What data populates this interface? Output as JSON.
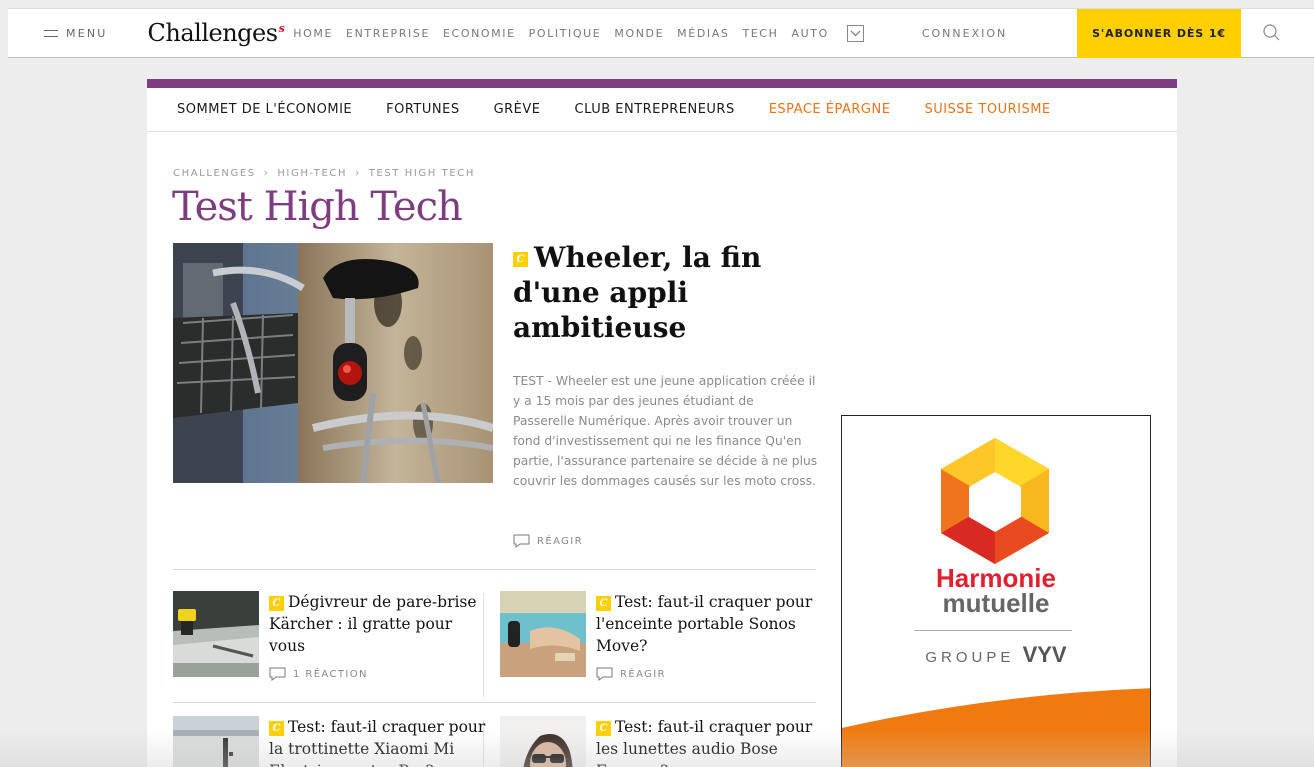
{
  "header": {
    "menu_label": "MENU",
    "logo": "Challenges",
    "nav": [
      "HOME",
      "ENTREPRISE",
      "ECONOMIE",
      "POLITIQUE",
      "MONDE",
      "MÉDIAS",
      "TECH",
      "AUTO"
    ],
    "connexion": "CONNEXION",
    "subscribe": "S'ABONNER DÈS 1€"
  },
  "subnav": [
    {
      "label": "SOMMET DE L'ÉCONOMIE",
      "color": "#1a1a1a"
    },
    {
      "label": "FORTUNES",
      "color": "#1a1a1a"
    },
    {
      "label": "GRÈVE",
      "color": "#1a1a1a"
    },
    {
      "label": "CLUB ENTREPRENEURS",
      "color": "#1a1a1a"
    },
    {
      "label": "ESPACE ÉPARGNE",
      "color": "#e8731a"
    },
    {
      "label": "SUISSE TOURISME",
      "color": "#e8731a"
    }
  ],
  "breadcrumb": [
    "CHALLENGES",
    "HIGH-TECH",
    "TEST HIGH TECH"
  ],
  "page_title": "Test High Tech",
  "badge_letter": "C",
  "hero": {
    "title": "Wheeler, la fin d'une appli ambitieuse",
    "description": "TEST - Wheeler est une jeune application créée il y a 15 mois par des jeunes étudiant de Passerelle Numérique. Après avoir trouver un fond d'investissement qui ne les finance Qu'en partie, l'assurance partenaire se décide à ne plus couvrir les dommages causés sur les moto cross.",
    "reaction": "RÉAGIR"
  },
  "articles": [
    {
      "title": "Dégivreur de pare-brise Kärcher : il gratte pour vous",
      "reaction": "1 RÉACTION"
    },
    {
      "title": "Test: faut-il craquer pour l'enceinte portable Sonos Move?",
      "reaction": "RÉAGIR"
    },
    {
      "title": "Test: faut-il craquer pour la trottinette Xiaomi Mi Electric scooter Pro?",
      "reaction": ""
    },
    {
      "title": "Test: faut-il craquer pour les lunettes audio Bose Frames ?",
      "reaction": ""
    }
  ],
  "ad": {
    "brand_line1": "Harmonie",
    "brand_line2": "mutuelle",
    "group_label": "GROUPE",
    "group_brand": "VYV"
  },
  "colors": {
    "accent_purple": "#7e3d80",
    "subscribe_yellow": "#ffcf00",
    "highlight_orange": "#e8731a",
    "ad_red": "#e0202f",
    "ad_orange": "#f07a10"
  }
}
